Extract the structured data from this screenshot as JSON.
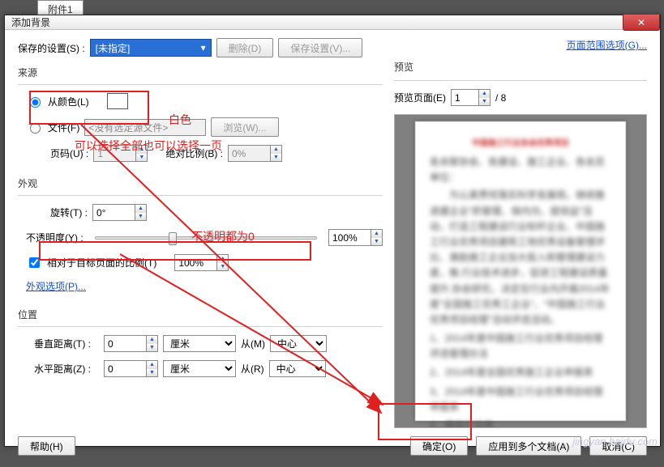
{
  "backdrop_tab": "附件1",
  "window": {
    "title": "添加背景"
  },
  "toprow": {
    "saved_label": "保存的设置(S) :",
    "saved_value": "[未指定]",
    "delete_btn": "删除(D)",
    "save_btn": "保存设置(V)...",
    "page_range_link": "页面范围选项(G)..."
  },
  "source": {
    "legend": "来源",
    "from_color": "从颜色(L)",
    "from_file": "文件(F)",
    "file_placeholder": "<没有选定源文件>",
    "browse_btn": "浏览(W)...",
    "page_num_label": "页码(U) :",
    "page_num_value": "1",
    "abs_scale_label": "绝对比例(B) :",
    "abs_scale_value": "0%"
  },
  "appearance": {
    "legend": "外观",
    "rotate_label": "旋转(T) :",
    "rotate_value": "0°",
    "opacity_label": "不透明度(Y) :",
    "opacity_value": "100%",
    "rel_scale_check": "相对于目标页面的比例(T)",
    "rel_scale_value": "100%",
    "options_link": "外观选项(P)..."
  },
  "position": {
    "legend": "位置",
    "vdist_label": "垂直距离(T) :",
    "vdist_value": "0",
    "vdist_unit": "厘米",
    "vdist_from": "从(M)",
    "vdist_from_value": "中心",
    "hdist_label": "水平距离(Z) :",
    "hdist_value": "0",
    "hdist_unit": "厘米",
    "hdist_from": "从(R)",
    "hdist_from_value": "中心"
  },
  "preview": {
    "legend": "预览",
    "page_label": "预览页面(E)",
    "page_value": "1",
    "page_total": "/ 8"
  },
  "footer": {
    "help": "帮助(H)",
    "ok": "确定(O)",
    "apply_multi": "应用到多个文档(A)",
    "cancel": "取消(C)"
  },
  "annotations": {
    "white": "白色",
    "select_hint": "可以选择全部也可以选择一页",
    "opacity_zero": "不透明都为0"
  },
  "watermark": "jingyan.baidu.com"
}
